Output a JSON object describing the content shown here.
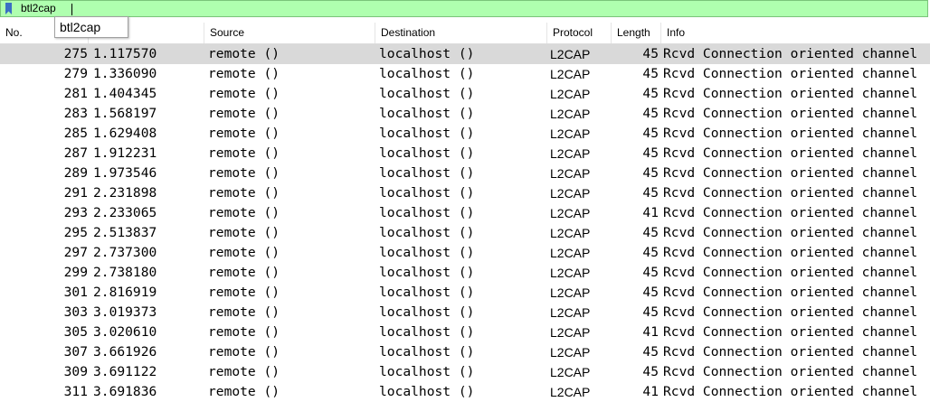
{
  "filter": {
    "value": "btl2cap",
    "suggestions": [
      "btl2cap"
    ]
  },
  "columns": [
    {
      "key": "no",
      "label": "No."
    },
    {
      "key": "time",
      "label": ""
    },
    {
      "key": "source",
      "label": "Source"
    },
    {
      "key": "destination",
      "label": "Destination"
    },
    {
      "key": "protocol",
      "label": "Protocol"
    },
    {
      "key": "length",
      "label": "Length"
    },
    {
      "key": "info",
      "label": "Info"
    }
  ],
  "packets": [
    {
      "no": "275",
      "time": "1.117570",
      "source": "remote ()",
      "destination": "localhost ()",
      "protocol": "L2CAP",
      "length": "45",
      "info": "Rcvd Connection oriented channel",
      "selected": true
    },
    {
      "no": "279",
      "time": "1.336090",
      "source": "remote ()",
      "destination": "localhost ()",
      "protocol": "L2CAP",
      "length": "45",
      "info": "Rcvd Connection oriented channel"
    },
    {
      "no": "281",
      "time": "1.404345",
      "source": "remote ()",
      "destination": "localhost ()",
      "protocol": "L2CAP",
      "length": "45",
      "info": "Rcvd Connection oriented channel"
    },
    {
      "no": "283",
      "time": "1.568197",
      "source": "remote ()",
      "destination": "localhost ()",
      "protocol": "L2CAP",
      "length": "45",
      "info": "Rcvd Connection oriented channel"
    },
    {
      "no": "285",
      "time": "1.629408",
      "source": "remote ()",
      "destination": "localhost ()",
      "protocol": "L2CAP",
      "length": "45",
      "info": "Rcvd Connection oriented channel"
    },
    {
      "no": "287",
      "time": "1.912231",
      "source": "remote ()",
      "destination": "localhost ()",
      "protocol": "L2CAP",
      "length": "45",
      "info": "Rcvd Connection oriented channel"
    },
    {
      "no": "289",
      "time": "1.973546",
      "source": "remote ()",
      "destination": "localhost ()",
      "protocol": "L2CAP",
      "length": "45",
      "info": "Rcvd Connection oriented channel"
    },
    {
      "no": "291",
      "time": "2.231898",
      "source": "remote ()",
      "destination": "localhost ()",
      "protocol": "L2CAP",
      "length": "45",
      "info": "Rcvd Connection oriented channel"
    },
    {
      "no": "293",
      "time": "2.233065",
      "source": "remote ()",
      "destination": "localhost ()",
      "protocol": "L2CAP",
      "length": "41",
      "info": "Rcvd Connection oriented channel"
    },
    {
      "no": "295",
      "time": "2.513837",
      "source": "remote ()",
      "destination": "localhost ()",
      "protocol": "L2CAP",
      "length": "45",
      "info": "Rcvd Connection oriented channel"
    },
    {
      "no": "297",
      "time": "2.737300",
      "source": "remote ()",
      "destination": "localhost ()",
      "protocol": "L2CAP",
      "length": "45",
      "info": "Rcvd Connection oriented channel"
    },
    {
      "no": "299",
      "time": "2.738180",
      "source": "remote ()",
      "destination": "localhost ()",
      "protocol": "L2CAP",
      "length": "45",
      "info": "Rcvd Connection oriented channel"
    },
    {
      "no": "301",
      "time": "2.816919",
      "source": "remote ()",
      "destination": "localhost ()",
      "protocol": "L2CAP",
      "length": "45",
      "info": "Rcvd Connection oriented channel"
    },
    {
      "no": "303",
      "time": "3.019373",
      "source": "remote ()",
      "destination": "localhost ()",
      "protocol": "L2CAP",
      "length": "45",
      "info": "Rcvd Connection oriented channel"
    },
    {
      "no": "305",
      "time": "3.020610",
      "source": "remote ()",
      "destination": "localhost ()",
      "protocol": "L2CAP",
      "length": "41",
      "info": "Rcvd Connection oriented channel"
    },
    {
      "no": "307",
      "time": "3.661926",
      "source": "remote ()",
      "destination": "localhost ()",
      "protocol": "L2CAP",
      "length": "45",
      "info": "Rcvd Connection oriented channel"
    },
    {
      "no": "309",
      "time": "3.691122",
      "source": "remote ()",
      "destination": "localhost ()",
      "protocol": "L2CAP",
      "length": "45",
      "info": "Rcvd Connection oriented channel"
    },
    {
      "no": "311",
      "time": "3.691836",
      "source": "remote ()",
      "destination": "localhost ()",
      "protocol": "L2CAP",
      "length": "41",
      "info": "Rcvd Connection oriented channel"
    }
  ],
  "colors": {
    "filter_valid": "#afffaf",
    "selected_row": "#d9d9d9",
    "bookmark": "#3a6fc4"
  },
  "icons": {
    "filter_bookmark": "bookmark-icon"
  }
}
